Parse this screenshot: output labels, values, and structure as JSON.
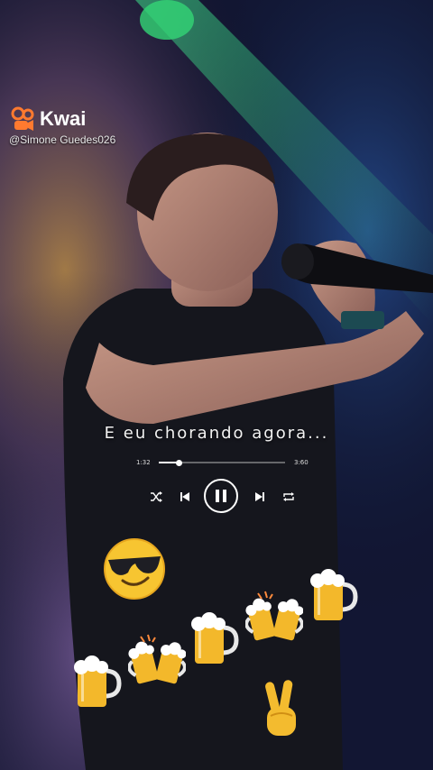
{
  "app": {
    "brand": "Kwai",
    "handle": "@Simone Guedes026"
  },
  "player": {
    "lyric": "E eu chorando agora...",
    "elapsed": "1:32",
    "duration": "3:60",
    "progress": 0.16
  },
  "colors": {
    "accent": "#ff7a2f",
    "text": "#ffffff",
    "background": "#0b0d1e"
  },
  "icons": {
    "shuffle": "shuffle-icon",
    "previous": "previous-icon",
    "pause": "pause-icon",
    "next": "next-icon",
    "repeat": "repeat-icon"
  },
  "stickers": [
    "sunglasses-emoji",
    "beer-mug-emoji",
    "clinking-beer-emoji",
    "beer-mug-emoji",
    "clinking-beer-emoji",
    "beer-mug-emoji",
    "victory-hand-emoji"
  ]
}
